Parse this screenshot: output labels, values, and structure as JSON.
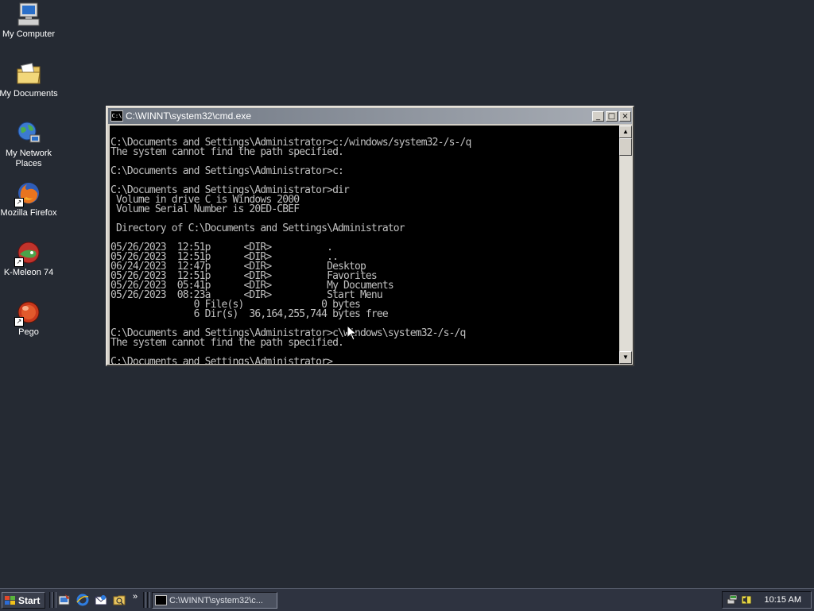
{
  "desktop": {
    "icons": [
      {
        "label": "My Computer",
        "icon": "computer-icon"
      },
      {
        "label": "My Documents",
        "icon": "folder-documents-icon"
      },
      {
        "label": "My Network Places",
        "icon": "network-places-icon"
      },
      {
        "label": "Mozilla Firefox",
        "icon": "firefox-icon"
      },
      {
        "label": "K-Meleon 74",
        "icon": "kmeleon-icon"
      },
      {
        "label": "Pego",
        "icon": "pego-icon"
      }
    ]
  },
  "cmd_window": {
    "title": "C:\\WINNT\\system32\\cmd.exe",
    "buttons": {
      "minimize": "_",
      "maximize": "□",
      "close": "×"
    },
    "lines": [
      "",
      "C:\\Documents and Settings\\Administrator>c:/windows/system32-/s-/q",
      "The system cannot find the path specified.",
      "",
      "C:\\Documents and Settings\\Administrator>c:",
      "",
      "C:\\Documents and Settings\\Administrator>dir",
      " Volume in drive C is Windows 2000",
      " Volume Serial Number is 20ED-CBEF",
      "",
      " Directory of C:\\Documents and Settings\\Administrator",
      "",
      "05/26/2023  12:51p      <DIR>          .",
      "05/26/2023  12:51p      <DIR>          ..",
      "06/24/2023  12:47p      <DIR>          Desktop",
      "05/26/2023  12:51p      <DIR>          Favorites",
      "05/26/2023  05:41p      <DIR>          My Documents",
      "05/26/2023  08:23a      <DIR>          Start Menu",
      "               0 File(s)              0 bytes",
      "               6 Dir(s)  36,164,255,744 bytes free",
      "",
      "C:\\Documents and Settings\\Administrator>c\\windows\\system32-/s-/q",
      "The system cannot find the path specified.",
      "",
      "C:\\Documents and Settings\\Administrator>"
    ]
  },
  "taskbar": {
    "start_label": "Start",
    "quick_launch": [
      "show-desktop-icon",
      "internet-explorer-icon",
      "outlook-express-icon",
      "explorer-icon"
    ],
    "overflow": "»",
    "task_button_label": "C:\\WINNT\\system32\\c...",
    "tray_icons": [
      "network-tray-icon",
      "volume-tray-icon"
    ],
    "clock": "10:15 AM"
  }
}
